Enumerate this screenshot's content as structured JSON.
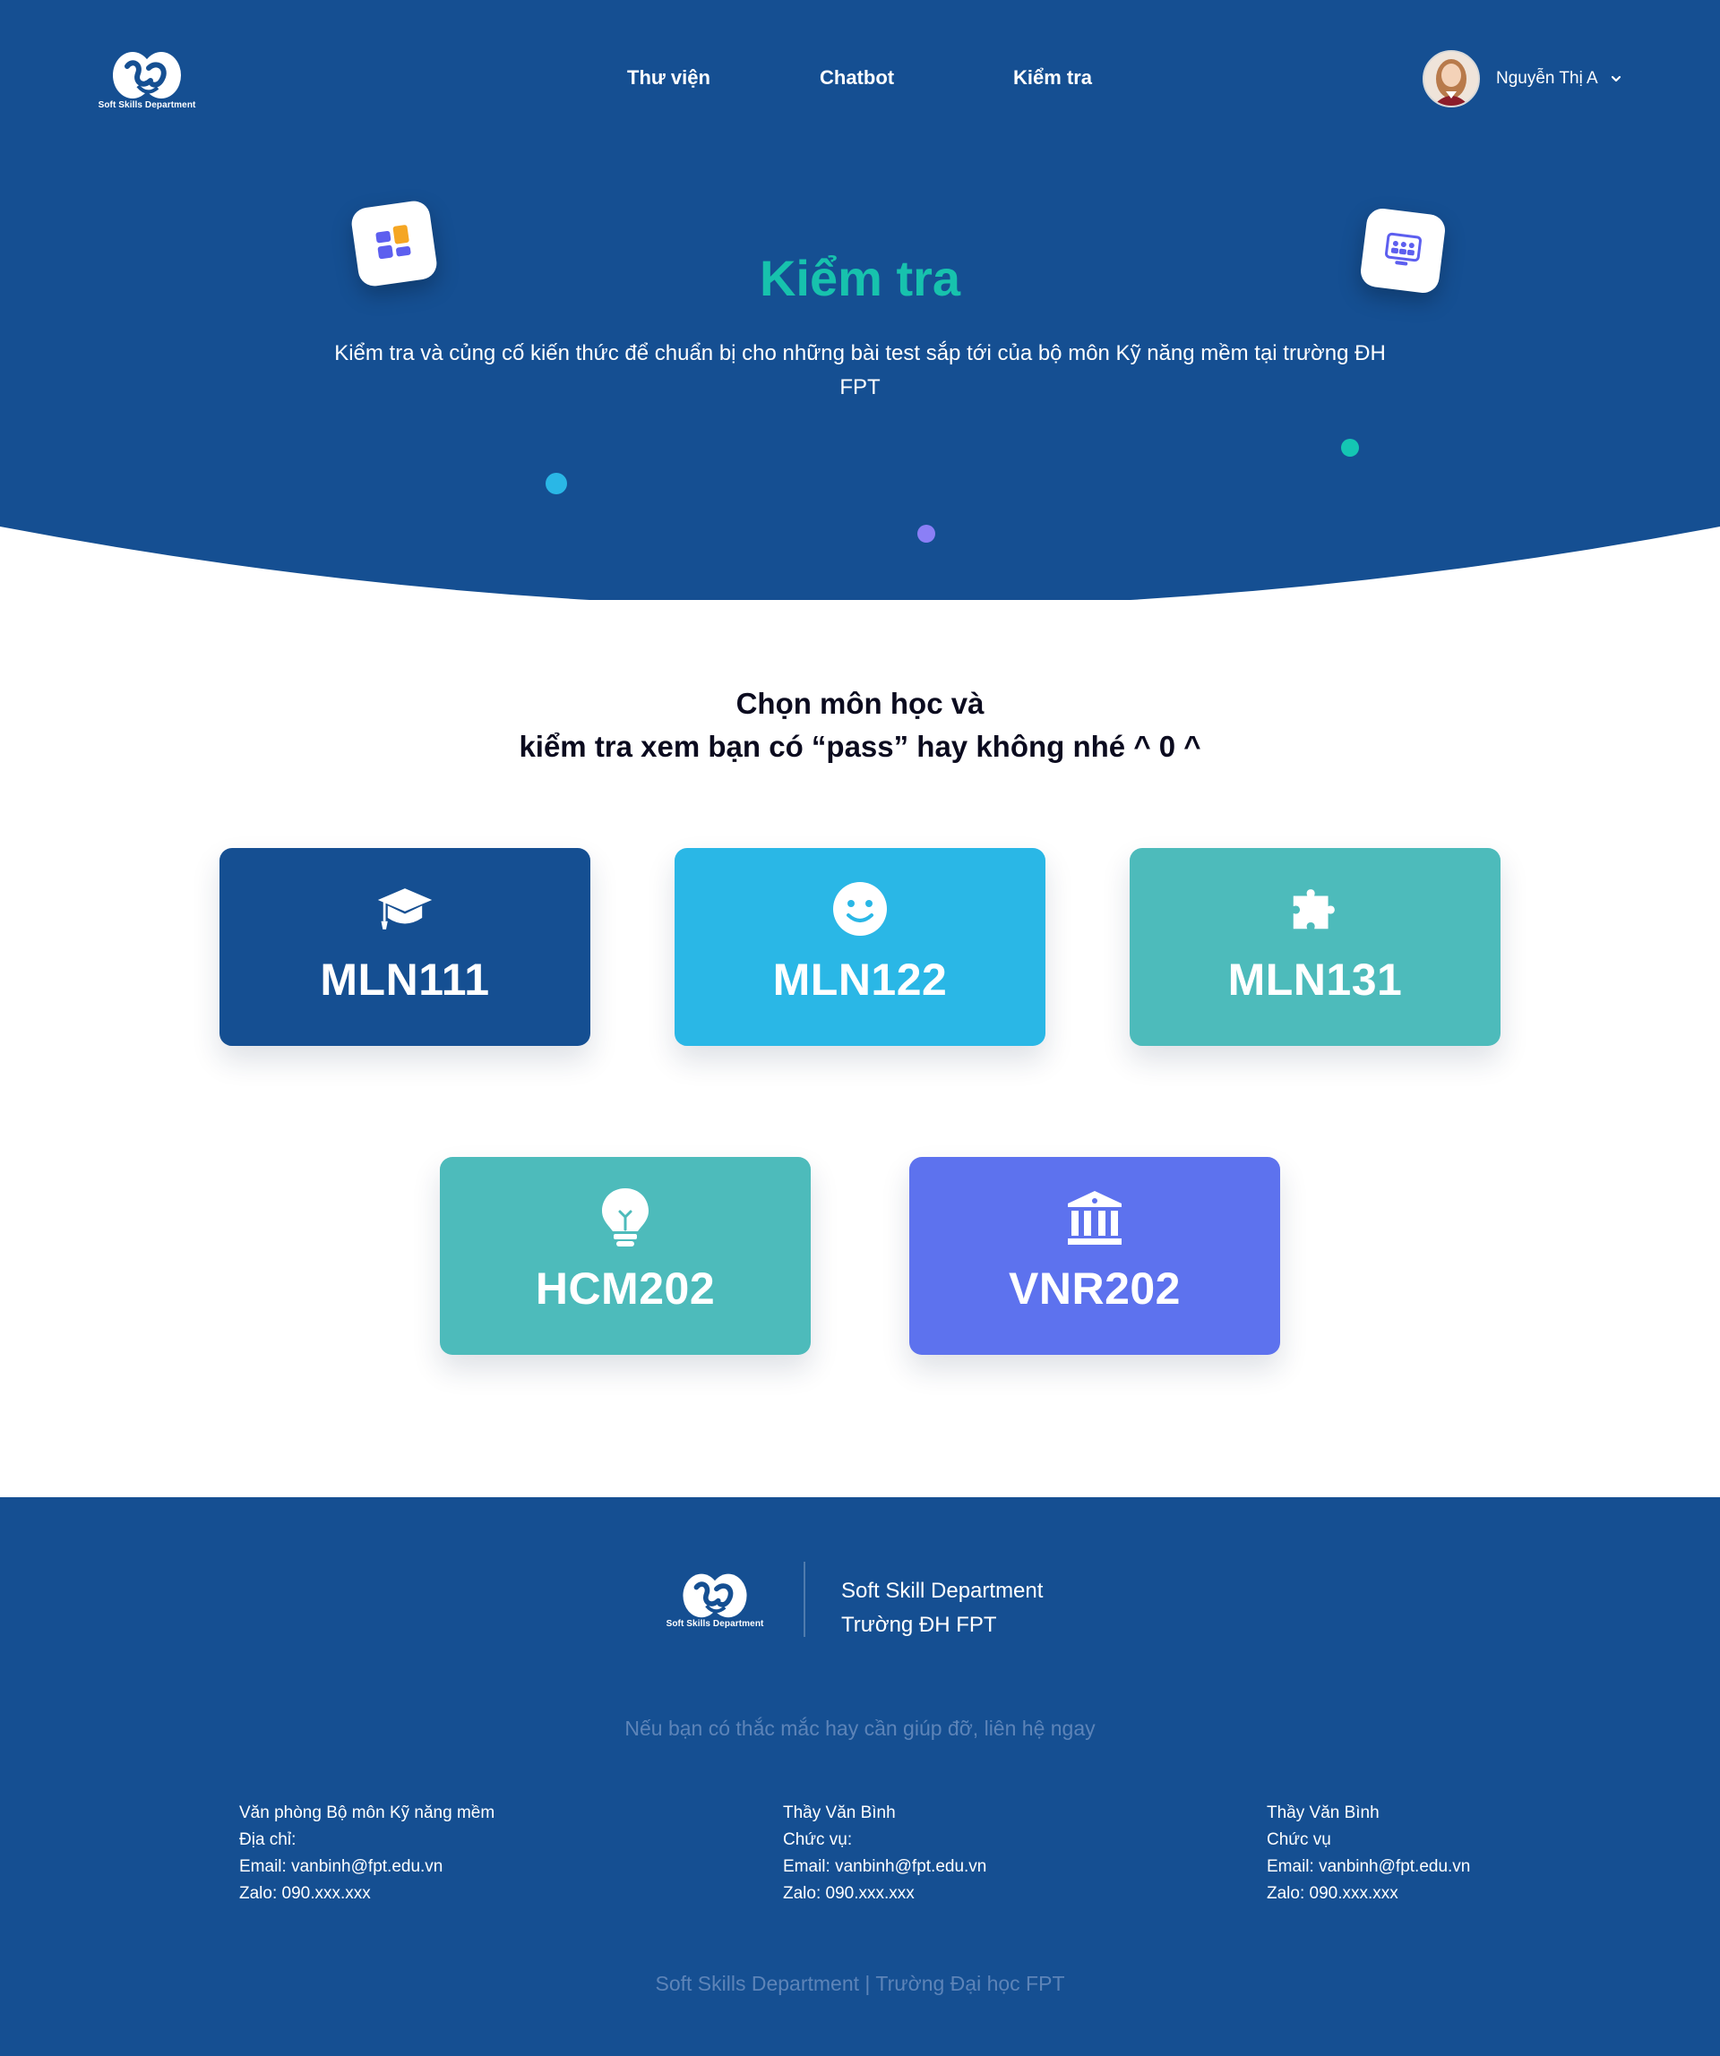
{
  "header": {
    "logo_text": "Soft Skills Department",
    "nav": [
      "Thư viện",
      "Chatbot",
      "Kiểm tra"
    ],
    "user_name": "Nguyễn Thị A"
  },
  "hero": {
    "title": "Kiểm tra",
    "subtitle": "Kiểm tra và củng cố kiến thức để chuẩn bị cho những bài test sắp tới của bộ môn Kỹ năng mềm tại trường ĐH FPT"
  },
  "section": {
    "title_line1": "Chọn môn học và",
    "title_line2": "kiểm tra xem bạn có “pass” hay không nhé ^ 0 ^"
  },
  "subjects": [
    {
      "code": "MLN111",
      "icon": "graduation-cap-icon",
      "color": "#154f92"
    },
    {
      "code": "MLN122",
      "icon": "smiley-icon",
      "color": "#2ab7e6"
    },
    {
      "code": "MLN131",
      "icon": "puzzle-icon",
      "color": "#4dbbbb"
    },
    {
      "code": "HCM202",
      "icon": "lightbulb-icon",
      "color": "#4dbbbb"
    },
    {
      "code": "VNR202",
      "icon": "bank-icon",
      "color": "#5d72ee"
    }
  ],
  "footer": {
    "logo_text": "Soft Skills Department",
    "brand_line1": "Soft Skill Department",
    "brand_line2": "Trường ĐH FPT",
    "help_text": "Nếu bạn có thắc mắc hay cần giúp đỡ, liên hệ ngay",
    "contacts": [
      {
        "line1": "Văn phòng Bộ môn Kỹ năng mềm",
        "line2": "Địa chỉ:",
        "line3": "Email: vanbinh@fpt.edu.vn",
        "line4": "Zalo: 090.xxx.xxx"
      },
      {
        "line1": "Thầy Văn Bình",
        "line2": "Chức vụ:",
        "line3": "Email: vanbinh@fpt.edu.vn",
        "line4": "Zalo: 090.xxx.xxx"
      },
      {
        "line1": "Thầy Văn Bình",
        "line2": "Chức vụ",
        "line3": "Email: vanbinh@fpt.edu.vn",
        "line4": "Zalo: 090.xxx.xxx"
      }
    ],
    "copyright": "Soft Skills Department | Trường Đại học FPT"
  },
  "colors": {
    "primary": "#154f92",
    "accent": "#17c2ad",
    "sky": "#2ab7e6",
    "teal": "#4dbbbb",
    "indigo": "#5d72ee"
  }
}
